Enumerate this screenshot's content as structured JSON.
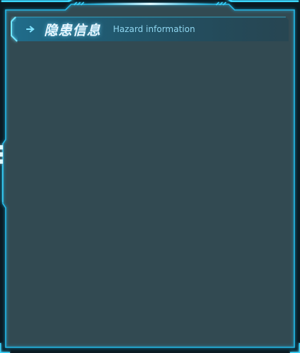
{
  "panel": {
    "title_cn": "隐患信息",
    "title_en": "Hazard information",
    "icons": {
      "header": "arrow-right-icon"
    },
    "colors": {
      "background": "#324a52",
      "border": "#1fb6e6",
      "glow": "#35d0ff",
      "title": "#e6f6ff",
      "subtitle": "#8fd6f0"
    }
  }
}
